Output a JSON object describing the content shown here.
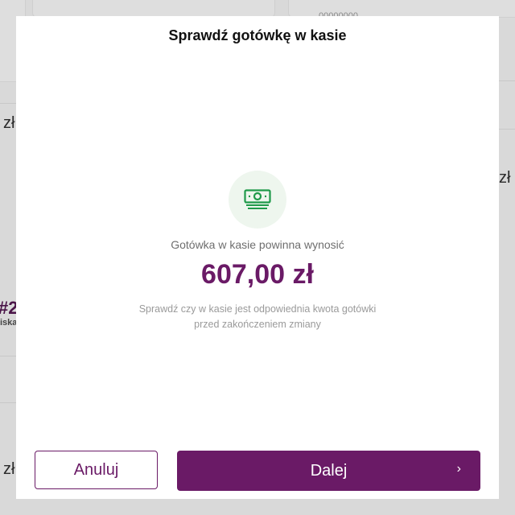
{
  "background": {
    "currency_fragments": [
      "zł",
      "zł",
      "zł"
    ],
    "order_number_fragment": "#2",
    "order_label_fragment": "iska",
    "top_code_fragment": "00000000"
  },
  "modal": {
    "title": "Sprawdź gotówkę w kasie",
    "icon": "banknote-icon",
    "expected_label": "Gotówka w kasie powinna wynosić",
    "amount": "607,00 zł",
    "note": "Sprawdź czy w kasie jest odpowiednia kwota gotówki przed zakończeniem zmiany",
    "cancel_label": "Anuluj",
    "next_label": "Dalej",
    "next_icon": "chevron-right-icon"
  },
  "colors": {
    "accent": "#6a1a66",
    "icon_green": "#1f9a4a",
    "icon_bg": "#eef6ee"
  }
}
